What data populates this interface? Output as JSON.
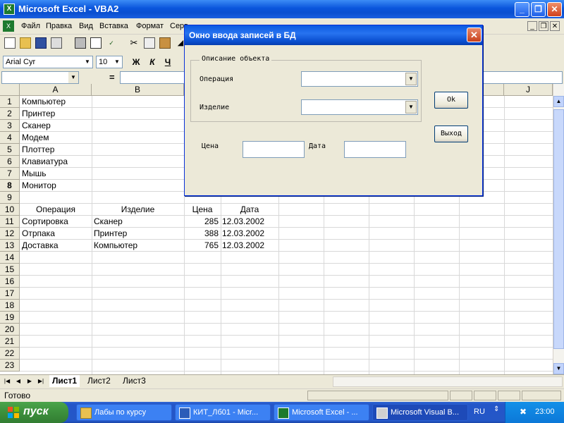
{
  "window": {
    "title": "Microsoft Excel - VBA2",
    "app_icon_glyph": "X"
  },
  "menu": {
    "items": [
      "Файл",
      "Правка",
      "Вид",
      "Вставка",
      "Формат",
      "Серв"
    ]
  },
  "toolbar": {
    "font_name": "Arial Cyr",
    "font_size": "10",
    "bold_label": "Ж",
    "italic_label": "К",
    "underline_label": "Ч"
  },
  "formula_bar": {
    "name_box": "",
    "equals": "=",
    "formula": ""
  },
  "columns": [
    "A",
    "B",
    "",
    "",
    "",
    "",
    "",
    "",
    "",
    "",
    "",
    "J"
  ],
  "rows": [
    "1",
    "2",
    "3",
    "4",
    "5",
    "6",
    "7",
    "8",
    "9",
    "10",
    "11",
    "12",
    "13",
    "14",
    "15",
    "16",
    "17",
    "18",
    "19",
    "20",
    "21",
    "22",
    "23"
  ],
  "active_row": "8",
  "cells": {
    "list_a": [
      "Компьютер",
      "Принтер",
      "Сканер",
      "Модем",
      "Плоттер",
      "Клавиатура",
      "Мышь",
      "Монитор"
    ],
    "table_headers": [
      "Операция",
      "Изделие",
      "Цена",
      "Дата"
    ],
    "table_rows": [
      [
        "Сортировка",
        "Сканер",
        "285",
        "12.03.2002"
      ],
      [
        "Отрпака",
        "Принтер",
        "388",
        "12.03.2002"
      ],
      [
        "Доставка",
        "Компьютер",
        "765",
        "12.03.2002"
      ]
    ]
  },
  "sheets": [
    "Лист1",
    "Лист2",
    "Лист3"
  ],
  "status": "Готово",
  "dialog": {
    "title": "Окно ввода записей в БД",
    "group_label": "Описание объекта",
    "operation_label": "Операция",
    "product_label": "Изделие",
    "price_label": "Цена",
    "date_label": "Дата",
    "ok_label": "Ok",
    "exit_label": "Выход",
    "operation_value": "",
    "product_value": "",
    "price_value": "",
    "date_value": ""
  },
  "taskbar": {
    "start_label": "пуск",
    "tasks": [
      "Лабы по курсу",
      "КИТ_Лб01 - Micr...",
      "Microsoft Excel - ...",
      "Microsoft Visual B..."
    ],
    "language": "RU",
    "clock": "23:00"
  },
  "colors": {
    "titlebar": "#0a55dc",
    "taskbar": "#2456c8",
    "start": "#3c8f3c",
    "excel_green": "#1d7a2e"
  }
}
